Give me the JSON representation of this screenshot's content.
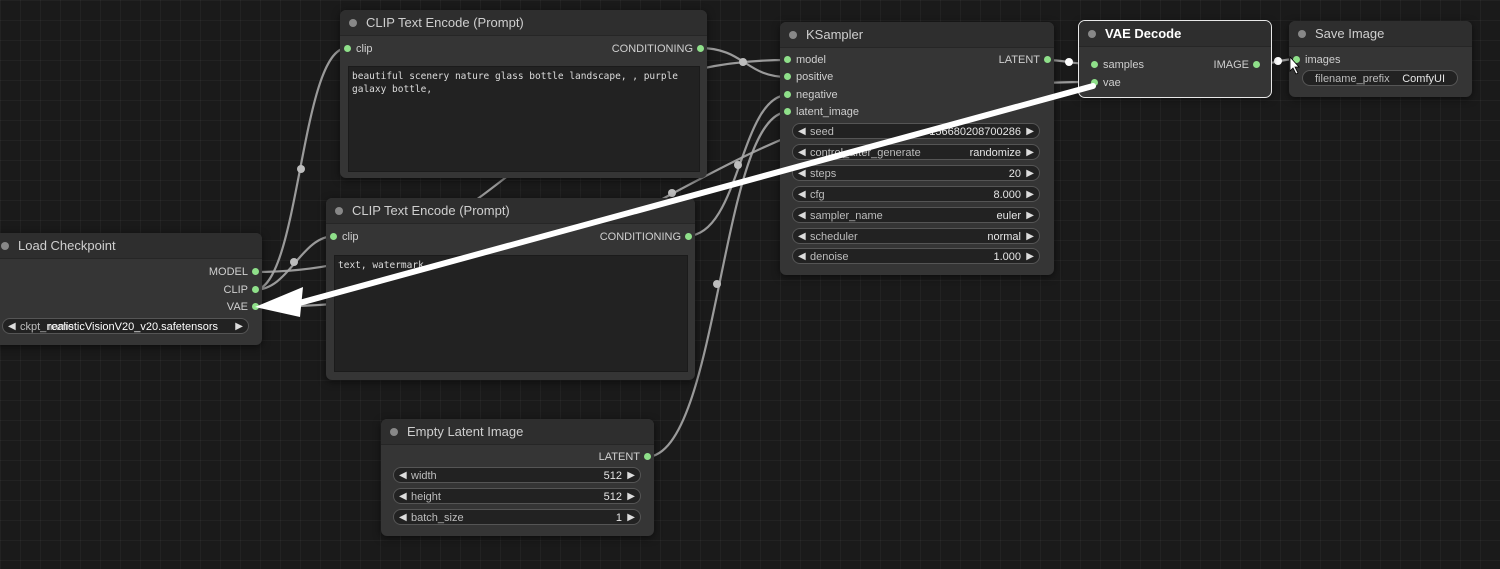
{
  "colors": {
    "canvas": "#1a1a1a",
    "node": "#353535",
    "slot": "#8fe08a",
    "wire": "#a8a8a8",
    "drag_arrow": "#ffffff"
  },
  "nodes": {
    "load_checkpoint": {
      "title": "Load Checkpoint",
      "outputs": [
        "MODEL",
        "CLIP",
        "VAE"
      ],
      "widget": {
        "name": "ckpt_name",
        "value": "realisticVisionV20_v20.safetensors"
      }
    },
    "clip_positive": {
      "title": "CLIP Text Encode (Prompt)",
      "input": "clip",
      "output": "CONDITIONING",
      "text": "beautiful scenery nature glass bottle landscape, , purple galaxy bottle,"
    },
    "clip_negative": {
      "title": "CLIP Text Encode (Prompt)",
      "input": "clip",
      "output": "CONDITIONING",
      "text": "text, watermark"
    },
    "empty_latent": {
      "title": "Empty Latent Image",
      "output": "LATENT",
      "widgets": [
        {
          "name": "width",
          "value": "512"
        },
        {
          "name": "height",
          "value": "512"
        },
        {
          "name": "batch_size",
          "value": "1"
        }
      ]
    },
    "ksampler": {
      "title": "KSampler",
      "inputs": [
        "model",
        "positive",
        "negative",
        "latent_image"
      ],
      "output": "LATENT",
      "widgets": [
        {
          "name": "seed",
          "value": "156680208700286"
        },
        {
          "name": "control_after_generate",
          "value": "randomize"
        },
        {
          "name": "steps",
          "value": "20"
        },
        {
          "name": "cfg",
          "value": "8.000"
        },
        {
          "name": "sampler_name",
          "value": "euler"
        },
        {
          "name": "scheduler",
          "value": "normal"
        },
        {
          "name": "denoise",
          "value": "1.000"
        }
      ]
    },
    "vae_decode": {
      "title": "VAE Decode",
      "inputs": [
        "samples",
        "vae"
      ],
      "output": "IMAGE"
    },
    "save_image": {
      "title": "Save Image",
      "input": "images",
      "widget": {
        "name": "filename_prefix",
        "value": "ComfyUI"
      }
    }
  }
}
